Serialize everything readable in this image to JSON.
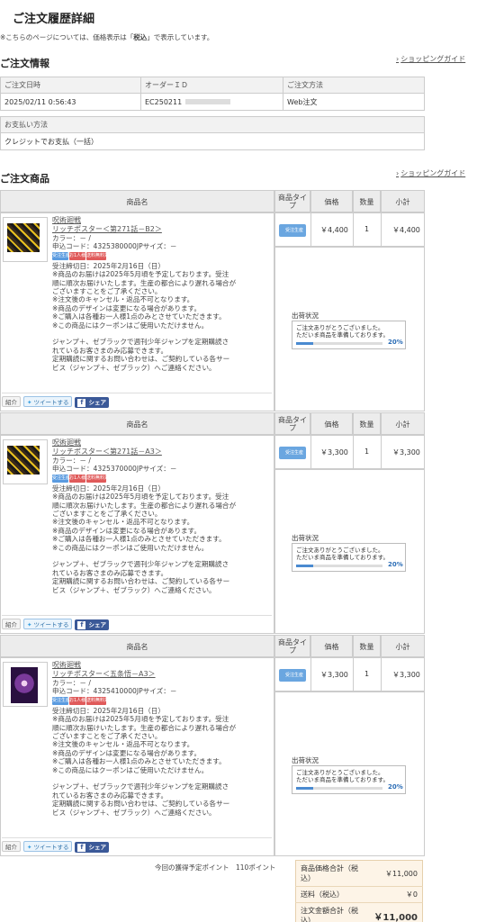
{
  "page_title": "ご注文履歴詳細",
  "tax_note": {
    "pre": "※こちらのページについては、価格表示は「",
    "bold": "税込",
    "post": "」で表示しています。"
  },
  "shopping_guide": "ショッピングガイド",
  "order_info": {
    "heading": "ご注文情報",
    "headers": [
      "ご注文日時",
      "オーダーＩＤ",
      "ご注文方法"
    ],
    "values": [
      "2025/02/11 0:56:43",
      "EC250211",
      "Web注文"
    ],
    "payment_label": "お支払い方法",
    "payment_value": "クレジットでお支払（一括）"
  },
  "products_heading": "ご注文商品",
  "columns": {
    "name": "商品名",
    "type": "商品タイプ",
    "price": "価格",
    "qty": "数量",
    "subtotal": "小計"
  },
  "products": [
    {
      "brand": "呪術廻戦",
      "title": "リッチポスター＜第271話－B2＞",
      "color": "カラー：－ /",
      "code": "申込コード：4325380000JPサイズ：－",
      "price": "￥4,400",
      "qty": "1",
      "subtotal": "￥4,400",
      "type_label": "受注生産",
      "theme": "yellow"
    },
    {
      "brand": "呪術廻戦",
      "title": "リッチポスター＜第271話－A3＞",
      "color": "カラー：－ /",
      "code": "申込コード：4325370000JPサイズ：－",
      "price": "￥3,300",
      "qty": "1",
      "subtotal": "￥3,300",
      "type_label": "受注生産",
      "theme": "yellow"
    },
    {
      "brand": "呪術廻戦",
      "title": "リッチポスター＜五条悟－A3＞",
      "color": "カラー：－ /",
      "code": "申込コード：4325410000JPサイズ：－",
      "price": "￥3,300",
      "qty": "1",
      "subtotal": "￥3,300",
      "type_label": "受注生産",
      "theme": "purple"
    }
  ],
  "common_notes": [
    "受注締切日：2025年2月16日（日）",
    "※商品のお届けは2025年5月頃を予定しております。受注",
    "順に順次お届けいたします。生産の都合により遅れる場合が",
    "ございますことをご了承ください。",
    "※注文後のキャンセル・返品不可となります。",
    "※商品のデザインは変更になる場合があります。",
    "※ご購入は各種お一人様1点のみとさせていただきます。",
    "※この商品にはクーポンはご使用いただけません。",
    "",
    "ジャンプ＋、ゼブラックで週刊少年ジャンプを定期購読さ",
    "れているお客さまのみ応募できます。",
    "定期購読に関するお問い合わせは、ご契約している各サー",
    "ビス（ジャンプ＋、ゼブラック）へご連絡ください。"
  ],
  "badges": [
    "受注生産",
    "お1人様1点",
    "送料無料対象外"
  ],
  "share": {
    "intro": "紹介",
    "tweet": "ツイートする",
    "fb": "シェア"
  },
  "shipping": {
    "label": "出荷状況",
    "line1": "ご注文ありがとうございました。",
    "line2": "ただいま商品を準備しております。",
    "percent": "20%",
    "progress": 0.2
  },
  "points": "今回の獲得予定ポイント　110ポイント",
  "totals": [
    {
      "label": "商品価格合計（税込）",
      "value": "￥11,000"
    },
    {
      "label": "送料（税込）",
      "value": "￥0"
    },
    {
      "label": "注文金額合計（税込）",
      "value": "￥11,000"
    }
  ],
  "colors": {
    "type_blue": "#6aa6e0",
    "badge_red": "#e05a5a",
    "badge_blue": "#5a9be0",
    "progress": "#4a8ad0"
  }
}
